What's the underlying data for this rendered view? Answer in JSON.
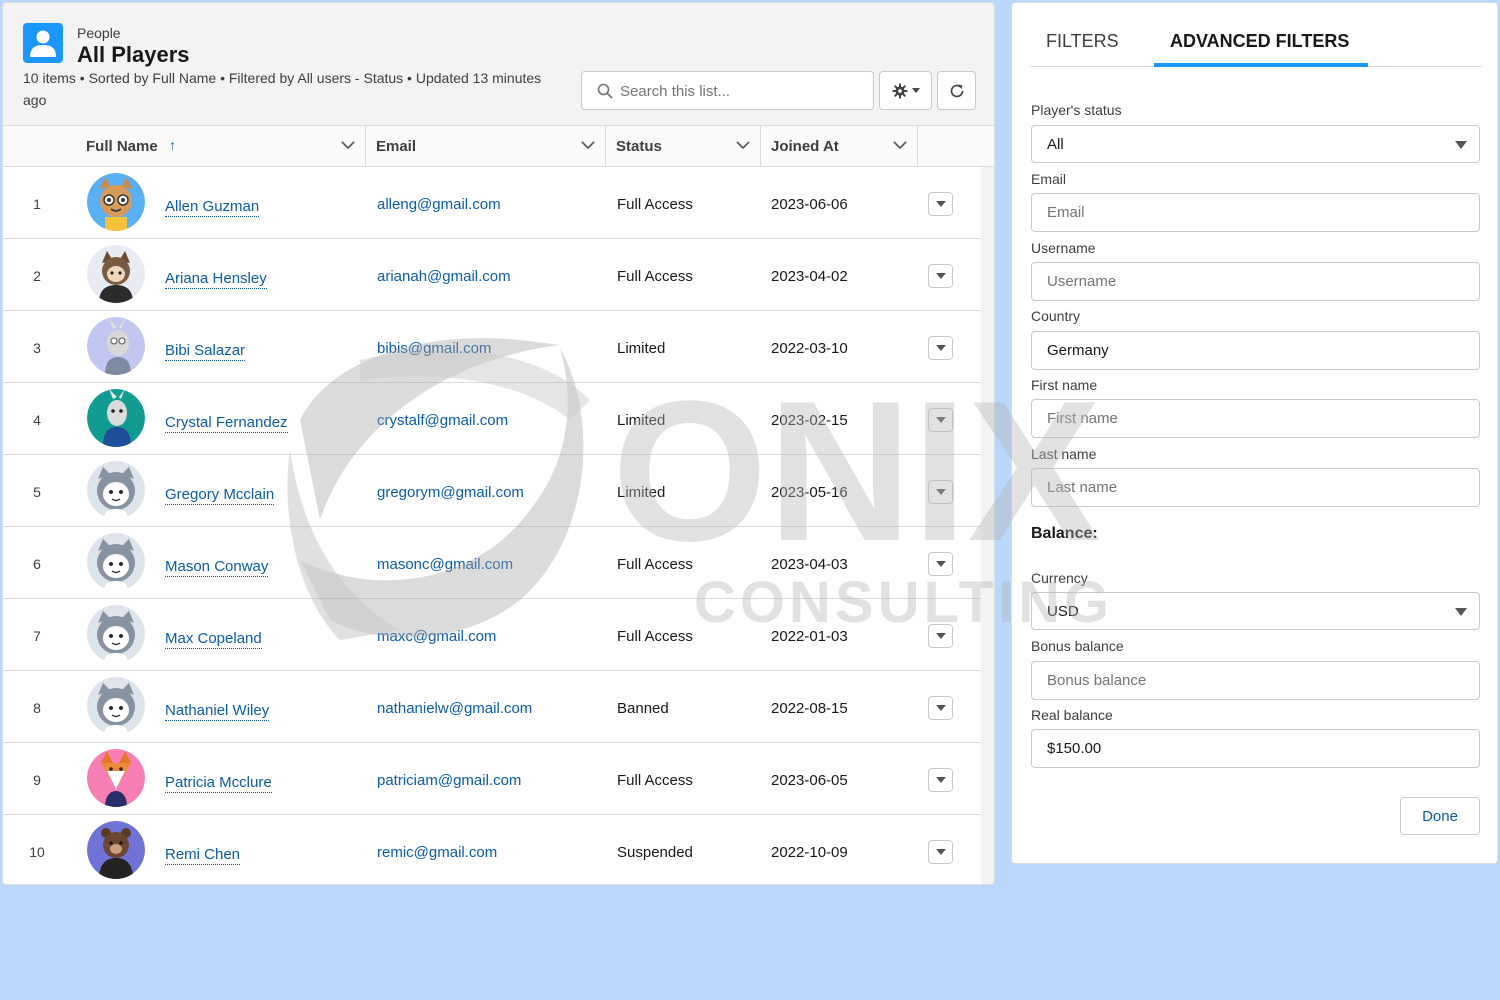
{
  "header": {
    "eyebrow": "People",
    "title": "All Players",
    "meta": "10 items • Sorted by Full Name • Filtered by All users - Status • Updated 13 minutes ago",
    "search_placeholder": "Search this list..."
  },
  "table": {
    "columns": [
      "Full Name",
      "Email",
      "Status",
      "Joined At"
    ],
    "sort_indicator": "↑",
    "rows": [
      {
        "num": "1",
        "name": "Allen Guzman",
        "email": "alleng@gmail.com",
        "status": "Full Access",
        "joined": "2023-06-06",
        "avatar": "cat-glasses"
      },
      {
        "num": "2",
        "name": "Ariana Hensley",
        "email": "arianah@gmail.com",
        "status": "Full Access",
        "joined": "2023-04-02",
        "avatar": "astro-black-shirt"
      },
      {
        "num": "3",
        "name": "Bibi Salazar",
        "email": "bibis@gmail.com",
        "status": "Limited",
        "joined": "2022-03-10",
        "avatar": "goat-purple"
      },
      {
        "num": "4",
        "name": "Crystal Fernandez",
        "email": "crystalf@gmail.com",
        "status": "Limited",
        "joined": "2023-02-15",
        "avatar": "goat-teal"
      },
      {
        "num": "5",
        "name": "Gregory Mcclain",
        "email": "gregorym@gmail.com",
        "status": "Limited",
        "joined": "2023-05-16",
        "avatar": "default-astro"
      },
      {
        "num": "6",
        "name": "Mason Conway",
        "email": "masonc@gmail.com",
        "status": "Full Access",
        "joined": "2023-04-03",
        "avatar": "default-astro"
      },
      {
        "num": "7",
        "name": "Max Copeland",
        "email": "maxc@gmail.com",
        "status": "Full Access",
        "joined": "2022-01-03",
        "avatar": "default-astro"
      },
      {
        "num": "8",
        "name": "Nathaniel Wiley",
        "email": "nathanielw@gmail.com",
        "status": "Banned",
        "joined": "2022-08-15",
        "avatar": "default-astro"
      },
      {
        "num": "9",
        "name": "Patricia Mcclure",
        "email": "patriciam@gmail.com",
        "status": "Full Access",
        "joined": "2023-06-05",
        "avatar": "fox-pink"
      },
      {
        "num": "10",
        "name": "Remi Chen",
        "email": "remic@gmail.com",
        "status": "Suspended",
        "joined": "2022-10-09",
        "avatar": "bear-purple"
      }
    ]
  },
  "filters": {
    "tabs": [
      "FILTERS",
      "ADVANCED FILTERS"
    ],
    "active_tab": "ADVANCED FILTERS",
    "status_label": "Player's status",
    "status_value": "All",
    "email_label": "Email",
    "email_placeholder": "Email",
    "username_label": "Username",
    "username_placeholder": "Username",
    "country_label": "Country",
    "country_value": "Germany",
    "first_name_label": "First name",
    "first_name_placeholder": "First name",
    "last_name_label": "Last name",
    "last_name_placeholder": "Last name",
    "balance_heading": "Balance:",
    "currency_label": "Currency",
    "currency_value": "USD",
    "bonus_label": "Bonus balance",
    "bonus_placeholder": "Bonus balance",
    "real_label": "Real balance",
    "real_value": "$150.00",
    "done_label": "Done"
  },
  "watermark": {
    "line1": "ONIX",
    "line2": "CONSULTING"
  },
  "colors": {
    "brand_blue": "#1b96ff",
    "link_blue": "#0b5cab",
    "page_bg": "#b9d8fb"
  }
}
